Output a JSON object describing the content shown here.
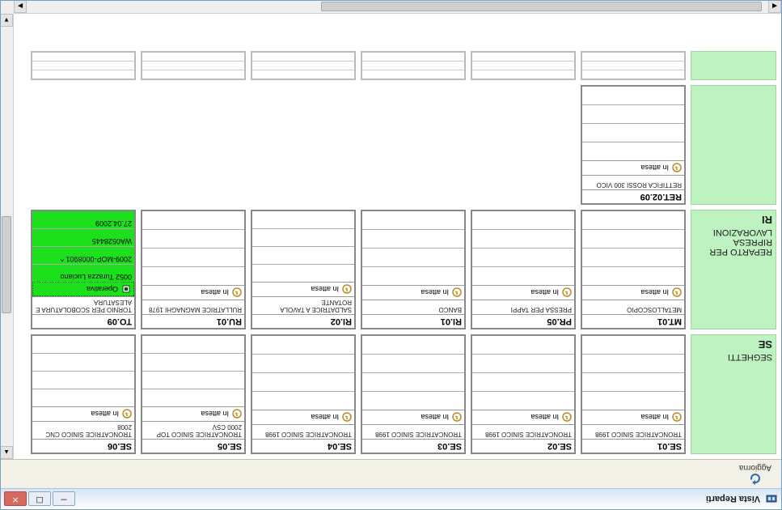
{
  "window": {
    "title": "Vista Reparti"
  },
  "toolbar": {
    "refresh": "Aggiorna"
  },
  "status_labels": {
    "waiting": "In attesa",
    "active": "Operativa"
  },
  "departments": [
    {
      "code": "SE",
      "name": "SEGHETTI",
      "machines": [
        {
          "code": "SE.01",
          "desc": "TRONCATRICE SINICO 1998",
          "status": "waiting",
          "rows": [
            "",
            "",
            "",
            ""
          ]
        },
        {
          "code": "SE.02",
          "desc": "TRONCATRICE SINICO 1998",
          "status": "waiting",
          "rows": [
            "",
            "",
            "",
            ""
          ]
        },
        {
          "code": "SE.03",
          "desc": "TRONCATRICE SINICO 1998",
          "status": "waiting",
          "rows": [
            "",
            "",
            "",
            ""
          ]
        },
        {
          "code": "SE.04",
          "desc": "TRONCATRICE SINICO 1998",
          "status": "waiting",
          "rows": [
            "",
            "",
            "",
            ""
          ]
        },
        {
          "code": "SE.05",
          "desc": "TRONCATRICE SINICO TOP 2000 CSV",
          "status": "waiting",
          "rows": [
            "",
            "",
            "",
            ""
          ]
        },
        {
          "code": "SE.06",
          "desc": "TRONCATRICE SINICO CNC 2008",
          "status": "waiting",
          "rows": [
            "",
            "",
            "",
            ""
          ]
        }
      ]
    },
    {
      "code": "RI",
      "name": "REPARTO PER RIPRESA LAVORAZIONI",
      "machines": [
        {
          "code": "MT.01",
          "desc": "METALLOSCOPIO",
          "status": "waiting",
          "rows": [
            "",
            "",
            "",
            ""
          ]
        },
        {
          "code": "PR.05",
          "desc": "PRESSA PER TAPPI",
          "status": "waiting",
          "rows": [
            "",
            "",
            "",
            ""
          ]
        },
        {
          "code": "RI.01",
          "desc": "BANCO",
          "status": "waiting",
          "rows": [
            "",
            "",
            "",
            ""
          ]
        },
        {
          "code": "RI.02",
          "desc": "SALDATRICE A TAVOLA ROTANTE",
          "status": "waiting",
          "rows": [
            "",
            "",
            "",
            ""
          ]
        },
        {
          "code": "RU.01",
          "desc": "RULLATRICE MAGNAGHI 1978",
          "status": "waiting",
          "rows": [
            "",
            "",
            "",
            ""
          ]
        },
        {
          "code": "TO.09",
          "desc": "TORNIO PER SCOBOLATURA E ALESATURA",
          "status": "active",
          "rows": [
            "0052  Turazza Luciano",
            "2009-MOP-0008901    ^",
            "WA0528445",
            "27.04.2009"
          ]
        }
      ]
    },
    {
      "code": "",
      "name": "",
      "machines": [
        {
          "code": "RET.02.09",
          "desc": "RETTIFICA ROSSI 300 VICO",
          "status": "waiting",
          "rows": [
            "",
            "",
            "",
            ""
          ]
        }
      ]
    }
  ]
}
